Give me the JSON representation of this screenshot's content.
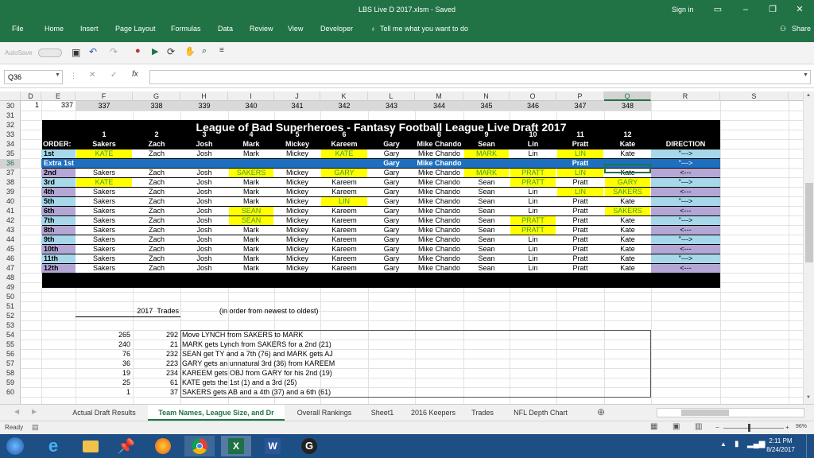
{
  "title_bar": {
    "title": "LBS Live D 2017.xlsm  -  Saved",
    "sign_in": "Sign in"
  },
  "menu": {
    "items": [
      "File",
      "Home",
      "Insert",
      "Page Layout",
      "Formulas",
      "Data",
      "Review",
      "View",
      "Developer"
    ],
    "tell_me": "Tell me what you want to do",
    "share": "Share"
  },
  "autosave": "AutoSave",
  "name_box": "Q36",
  "columns": [
    "D",
    "E",
    "F",
    "G",
    "H",
    "I",
    "J",
    "K",
    "L",
    "M",
    "N",
    "O",
    "P",
    "Q",
    "R",
    "S"
  ],
  "rows": [
    "30",
    "31",
    "32",
    "33",
    "34",
    "35",
    "36",
    "37",
    "38",
    "39",
    "40",
    "41",
    "42",
    "43",
    "44",
    "45",
    "46",
    "47",
    "48",
    "49",
    "50",
    "51",
    "52",
    "53",
    "54",
    "55",
    "56",
    "57",
    "58",
    "59",
    "60"
  ],
  "row30": [
    "1",
    "337",
    "337",
    "338",
    "339",
    "340",
    "341",
    "342",
    "343",
    "344",
    "345",
    "346",
    "347",
    "348"
  ],
  "board": {
    "title": "League of Bad Superheroes - Fantasy Football League Live Draft 2017",
    "numbers": [
      "1",
      "2",
      "3",
      "4",
      "5",
      "6",
      "7",
      "8",
      "9",
      "10",
      "11",
      "12"
    ],
    "order_label": "ORDER:",
    "teams": [
      "Sakers",
      "Zach",
      "Josh",
      "Mark",
      "Mickey",
      "Kareem",
      "Gary",
      "Mike Chando",
      "Sean",
      "Lin",
      "Pratt",
      "Kate"
    ],
    "direction_header": "DIRECTION",
    "rounds": [
      {
        "label": "1st",
        "cells": [
          "KATE",
          "Zach",
          "Josh",
          "Mark",
          "Mickey",
          "KATE",
          "Gary",
          "Mike Chando",
          "MARK",
          "Lin",
          "LIN",
          "Kate"
        ],
        "dir": "\"--->"
      },
      {
        "label": "Extra 1st",
        "cells": [
          "",
          "",
          "",
          "",
          "",
          "",
          "Gary",
          "Mike Chando",
          "",
          "",
          "Pratt",
          ""
        ],
        "dir": "\"--->"
      },
      {
        "label": "2nd",
        "cells": [
          "Sakers",
          "Zach",
          "Josh",
          "SAKERS",
          "Mickey",
          "GARY",
          "Gary",
          "Mike Chando",
          "MARK",
          "PRATT",
          "LIN",
          "Kate"
        ],
        "dir": "<---"
      },
      {
        "label": "3rd",
        "cells": [
          "KATE",
          "Zach",
          "Josh",
          "Mark",
          "Mickey",
          "Kareem",
          "Gary",
          "Mike Chando",
          "Sean",
          "PRATT",
          "Pratt",
          "GARY"
        ],
        "dir": "\"--->"
      },
      {
        "label": "4th",
        "cells": [
          "Sakers",
          "Zach",
          "Josh",
          "Mark",
          "Mickey",
          "Kareem",
          "Gary",
          "Mike Chando",
          "Sean",
          "Lin",
          "LIN",
          "SAKERS"
        ],
        "dir": "<---"
      },
      {
        "label": "5th",
        "cells": [
          "Sakers",
          "Zach",
          "Josh",
          "Mark",
          "Mickey",
          "LIN",
          "Gary",
          "Mike Chando",
          "Sean",
          "Lin",
          "Pratt",
          "Kate"
        ],
        "dir": "\"--->"
      },
      {
        "label": "6th",
        "cells": [
          "Sakers",
          "Zach",
          "Josh",
          "SEAN",
          "Mickey",
          "Kareem",
          "Gary",
          "Mike Chando",
          "Sean",
          "Lin",
          "Pratt",
          "SAKERS"
        ],
        "dir": "<---"
      },
      {
        "label": "7th",
        "cells": [
          "Sakers",
          "Zach",
          "Josh",
          "SEAN",
          "Mickey",
          "Kareem",
          "Gary",
          "Mike Chando",
          "Sean",
          "PRATT",
          "Pratt",
          "Kate"
        ],
        "dir": "\"--->"
      },
      {
        "label": "8th",
        "cells": [
          "Sakers",
          "Zach",
          "Josh",
          "Mark",
          "Mickey",
          "Kareem",
          "Gary",
          "Mike Chando",
          "Sean",
          "PRATT",
          "Pratt",
          "Kate"
        ],
        "dir": "<---"
      },
      {
        "label": "9th",
        "cells": [
          "Sakers",
          "Zach",
          "Josh",
          "Mark",
          "Mickey",
          "Kareem",
          "Gary",
          "Mike Chando",
          "Sean",
          "Lin",
          "Pratt",
          "Kate"
        ],
        "dir": "\"--->"
      },
      {
        "label": "10th",
        "cells": [
          "Sakers",
          "Zach",
          "Josh",
          "Mark",
          "Mickey",
          "Kareem",
          "Gary",
          "Mike Chando",
          "Sean",
          "Lin",
          "Pratt",
          "Kate"
        ],
        "dir": "<---"
      },
      {
        "label": "11th",
        "cells": [
          "Sakers",
          "Zach",
          "Josh",
          "Mark",
          "Mickey",
          "Kareem",
          "Gary",
          "Mike Chando",
          "Sean",
          "Lin",
          "Pratt",
          "Kate"
        ],
        "dir": "\"--->"
      },
      {
        "label": "12th",
        "cells": [
          "Sakers",
          "Zach",
          "Josh",
          "Mark",
          "Mickey",
          "Kareem",
          "Gary",
          "Mike Chando",
          "Sean",
          "Lin",
          "Pratt",
          "Kate"
        ],
        "dir": "<---"
      }
    ]
  },
  "trades": {
    "header_year": "2017",
    "header_label": "Trades",
    "note": "(in order from newest to oldest)",
    "rows": [
      {
        "a": "265",
        "b": "292",
        "text": "Move LYNCH from SAKERS to MARK"
      },
      {
        "a": "240",
        "b": "21",
        "text": "MARK gets Lynch from SAKERS for a 2nd (21)"
      },
      {
        "a": "76",
        "b": "232",
        "text": "SEAN get TY and a 7th (76) and MARK gets AJ"
      },
      {
        "a": "36",
        "b": "223",
        "text": "GARY gets an unnatural 3rd (36) from KAREEM"
      },
      {
        "a": "19",
        "b": "234",
        "text": "KAREEM gets OBJ from GARY for his 2nd (19)"
      },
      {
        "a": "25",
        "b": "61",
        "text": "KATE gets the 1st (1) and a 3rd (25)"
      },
      {
        "a": "1",
        "b": "37",
        "text": "SAKERS gets AB and a 4th (37) and a 6th (61)"
      }
    ]
  },
  "sheet_tabs": [
    "Actual Draft Results",
    "Team Names, League Size, and Dr",
    "Overall Rankings",
    "Sheet1",
    "2016 Keepers",
    "Trades",
    "NFL Depth Chart"
  ],
  "status": {
    "ready": "Ready",
    "zoom": "96%"
  },
  "clock": {
    "time": "2:11 PM",
    "date": "8/24/2017"
  },
  "colors": {
    "excel_green": "#217346",
    "header_black": "#000000",
    "highlight_yellow": "#ffff00",
    "selected_blue": "#1e6fbf",
    "odd_round": "#a6d8ea",
    "even_round": "#b4a7d6"
  }
}
